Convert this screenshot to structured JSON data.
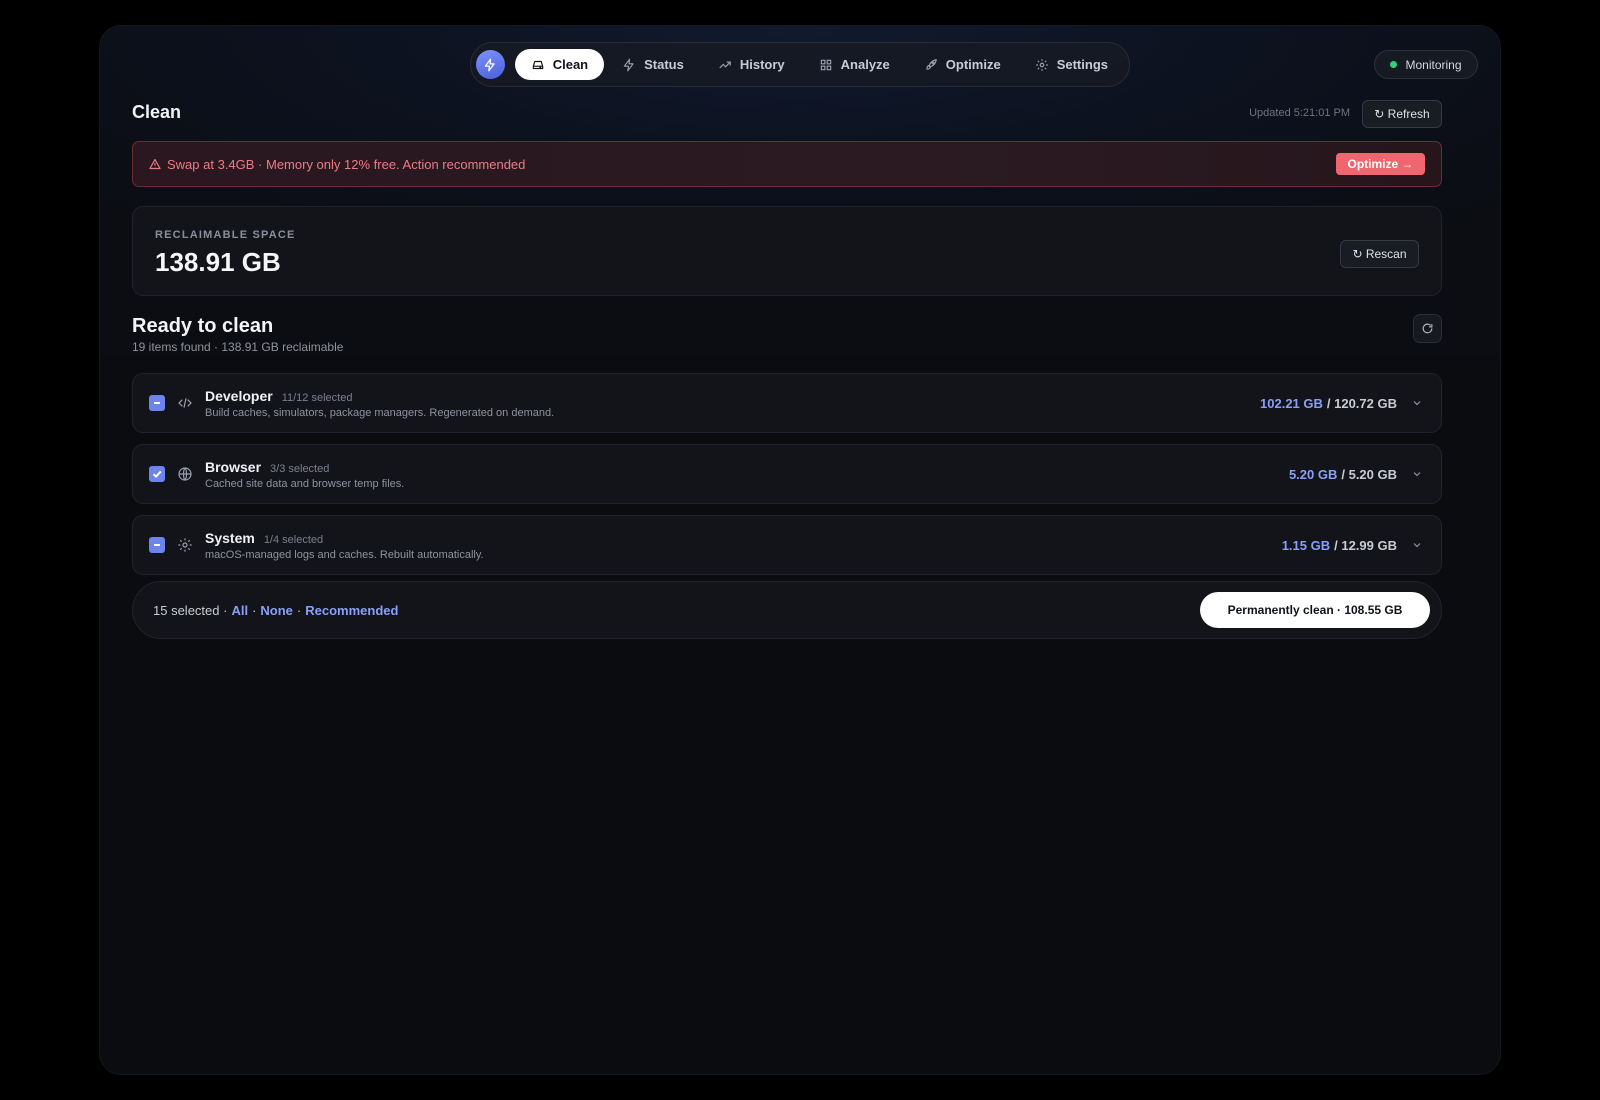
{
  "nav": {
    "tabs": [
      {
        "label": "Clean",
        "icon": "drive-icon"
      },
      {
        "label": "Status",
        "icon": "bolt-icon"
      },
      {
        "label": "History",
        "icon": "trend-icon"
      },
      {
        "label": "Analyze",
        "icon": "grid-icon"
      },
      {
        "label": "Optimize",
        "icon": "rocket-icon"
      },
      {
        "label": "Settings",
        "icon": "gear-icon"
      }
    ],
    "active": "Clean"
  },
  "monitoring": {
    "label": "Monitoring",
    "status_color": "#2ed47a"
  },
  "header": {
    "title": "Clean",
    "updated": "Updated 5:21:01 PM",
    "refresh_label": "↻ Refresh"
  },
  "alert": {
    "text": "Swap at 3.4GB · Memory only 12% free. Action recommended",
    "action_label": "Optimize →"
  },
  "reclaimable": {
    "label": "RECLAIMABLE SPACE",
    "value": "138.91 GB",
    "rescan_label": "↻ Rescan"
  },
  "section": {
    "title": "Ready to clean",
    "subtitle": "19 items found · 138.91 GB reclaimable"
  },
  "categories": [
    {
      "name": "Developer",
      "count": "11/12 selected",
      "desc": "Build caches, simulators, package managers. Regenerated on demand.",
      "selected": "102.21 GB",
      "total": "/ 120.72 GB",
      "state": "partial"
    },
    {
      "name": "Browser",
      "count": "3/3 selected",
      "desc": "Cached site data and browser temp files.",
      "selected": "5.20 GB",
      "total": "/ 5.20 GB",
      "state": "checked"
    },
    {
      "name": "System",
      "count": "1/4 selected",
      "desc": "macOS-managed logs and caches. Rebuilt automatically.",
      "selected": "1.15 GB",
      "total": "/ 12.99 GB",
      "state": "partial"
    }
  ],
  "footer": {
    "selected_text": "15 selected ·",
    "all": "All",
    "sep1": "·",
    "none": "None",
    "sep2": "·",
    "recommended": "Recommended",
    "clean_label": "Permanently clean · 108.55 GB"
  },
  "colors": {
    "accent": "#6d83ee",
    "danger": "#f0666e",
    "success": "#2ed47a"
  }
}
